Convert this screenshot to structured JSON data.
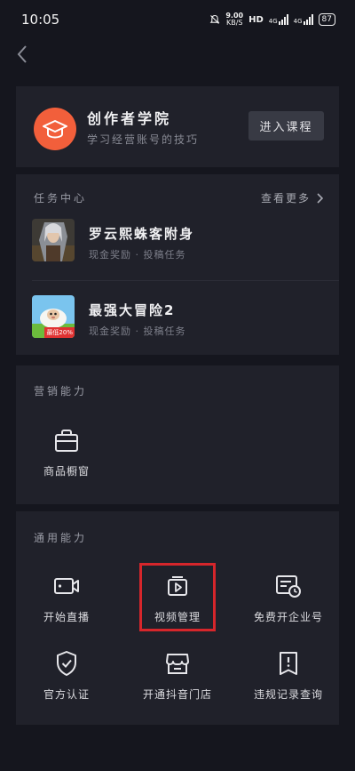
{
  "status_bar": {
    "time": "10:05",
    "net_speed_value": "9.00",
    "net_speed_unit": "KB/S",
    "hd_label": "HD",
    "signal_1_label": "4G",
    "signal_2_label": "4G",
    "battery": "87"
  },
  "header": {
    "back_icon": "chevron-left-icon"
  },
  "academy": {
    "icon": "graduation-cap-icon",
    "icon_color": "#f25f3b",
    "title": "创作者学院",
    "subtitle": "学习经营账号的技巧",
    "enter_label": "进入课程"
  },
  "task_center": {
    "heading": "任务中心",
    "see_more": "查看更多",
    "tasks": [
      {
        "title": "罗云熙蛛客附身",
        "subtitle": "现金奖励 · 投稿任务"
      },
      {
        "title": "最强大冒险2",
        "subtitle": "现金奖励 · 投稿任务",
        "badge": "最低20%"
      }
    ]
  },
  "marketing": {
    "heading": "营销能力",
    "tools": [
      {
        "label": "商品橱窗",
        "icon": "shop-window-icon"
      }
    ]
  },
  "general": {
    "heading": "通用能力",
    "tools": [
      {
        "label": "开始直播",
        "icon": "video-camera-icon"
      },
      {
        "label": "视频管理",
        "icon": "video-manage-icon"
      },
      {
        "label": "免费开企业号",
        "icon": "enterprise-account-icon"
      },
      {
        "label": "官方认证",
        "icon": "shield-check-icon"
      },
      {
        "label": "开通抖音门店",
        "icon": "store-icon"
      },
      {
        "label": "违规记录查询",
        "icon": "violation-record-icon"
      }
    ]
  },
  "colors": {
    "highlight": "#d6262b",
    "card_bg": "#20212a",
    "page_bg": "#15161e"
  }
}
